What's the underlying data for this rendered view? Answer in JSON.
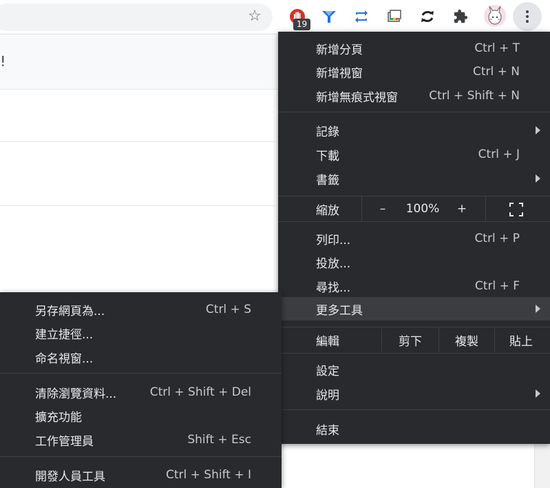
{
  "toolbar": {
    "bookmark_icon": "star-outline-icon",
    "extensions": [
      {
        "name": "red-hand-extension-icon",
        "badge": "19",
        "color": "#d93025"
      },
      {
        "name": "blue-gem-extension-icon",
        "color": "#1a73e8"
      },
      {
        "name": "blue-arrows-extension-icon",
        "color": "#1a73e8"
      },
      {
        "name": "window-extension-icon",
        "color": "#5f6368"
      },
      {
        "name": "refresh-extension-icon",
        "color": "#202124"
      },
      {
        "name": "puzzle-extensions-icon",
        "color": "#3c4043"
      }
    ],
    "profile": "profile-avatar",
    "menu_button": "three-dot-menu-icon"
  },
  "page": {
    "header_text": "e!"
  },
  "main_menu": {
    "new_tab": {
      "label": "新增分頁",
      "shortcut": "Ctrl + T"
    },
    "new_window": {
      "label": "新增視窗",
      "shortcut": "Ctrl + N"
    },
    "new_incognito": {
      "label": "新增無痕式視窗",
      "shortcut": "Ctrl + Shift + N"
    },
    "history": {
      "label": "記錄"
    },
    "downloads": {
      "label": "下載",
      "shortcut": "Ctrl + J"
    },
    "bookmarks": {
      "label": "書籤"
    },
    "zoom": {
      "label": "縮放",
      "minus": "–",
      "value": "100%",
      "plus": "+"
    },
    "print": {
      "label": "列印...",
      "shortcut": "Ctrl + P"
    },
    "cast": {
      "label": "投放..."
    },
    "find": {
      "label": "尋找...",
      "shortcut": "Ctrl + F"
    },
    "more_tools": {
      "label": "更多工具"
    },
    "edit": {
      "label": "編輯",
      "cut": "剪下",
      "copy": "複製",
      "paste": "貼上"
    },
    "settings": {
      "label": "設定"
    },
    "help": {
      "label": "說明"
    },
    "exit": {
      "label": "結束"
    }
  },
  "more_tools_menu": {
    "save_page_as": {
      "label": "另存網頁為...",
      "shortcut": "Ctrl + S"
    },
    "create_shortcut": {
      "label": "建立捷徑..."
    },
    "name_window": {
      "label": "命名視窗..."
    },
    "clear_browsing_data": {
      "label": "清除瀏覽資料...",
      "shortcut": "Ctrl + Shift + Del"
    },
    "extensions": {
      "label": "擴充功能"
    },
    "task_manager": {
      "label": "工作管理員",
      "shortcut": "Shift + Esc"
    },
    "developer_tools": {
      "label": "開發人員工具",
      "shortcut": "Ctrl + Shift + I"
    }
  }
}
